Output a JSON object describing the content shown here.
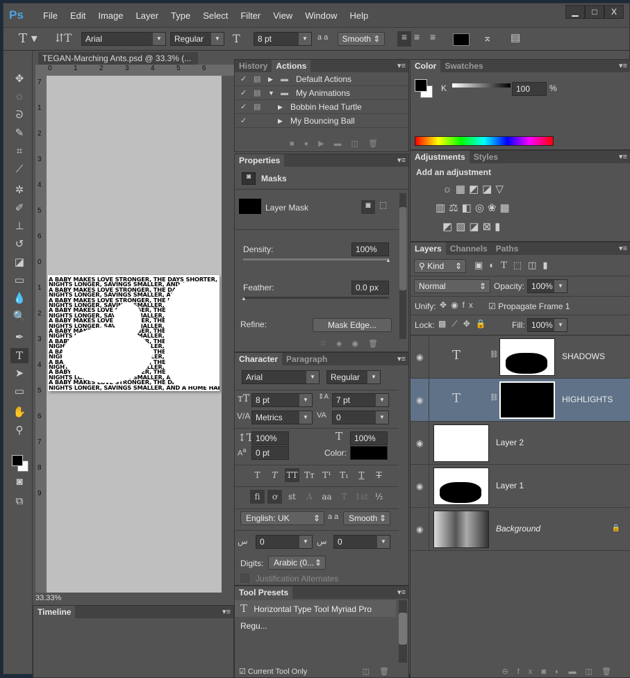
{
  "app": {
    "logo": "Ps",
    "menu": [
      "File",
      "Edit",
      "Image",
      "Layer",
      "Type",
      "Select",
      "Filter",
      "View",
      "Window",
      "Help"
    ],
    "window_buttons": [
      "minimize",
      "maximize",
      "close"
    ]
  },
  "options": {
    "tool_icon": "horizontal-type-icon",
    "font": "Arial",
    "style": "Regular",
    "size": "8 pt",
    "aa_label": "a a",
    "antialias": "Smooth",
    "text_color": "#000000"
  },
  "document": {
    "tab_title": "TEGAN-Marching Ants.psd @ 33.3% (...",
    "close": "×",
    "ruler_h": [
      "0",
      "1",
      "2",
      "3",
      "4",
      "5",
      "6"
    ],
    "ruler_v": [
      "7",
      "1",
      "2",
      "3",
      "4",
      "5",
      "6",
      "0",
      "1",
      "2",
      "3",
      "4",
      "5",
      "6",
      "7",
      "8",
      "9"
    ],
    "zoom": "33.33%",
    "art_text": [
      "A BABY MAKES LOVE STRONGER, THE DAYS SHORTER, THE",
      "NIGHTS LONGER, SAVINGS SMALLER, AND A HOME HAPPIERA"
    ]
  },
  "timeline": {
    "title": "Timeline"
  },
  "history_actions": {
    "tabs": [
      "History",
      "Actions"
    ],
    "items": [
      {
        "label": "Default Actions",
        "type": "set",
        "expanded": false
      },
      {
        "label": "My Animations",
        "type": "set",
        "expanded": true
      },
      {
        "label": "Bobbin Head Turtle",
        "type": "action"
      },
      {
        "label": "My Bouncing Ball",
        "type": "action"
      }
    ]
  },
  "properties": {
    "tab": "Properties",
    "section": "Masks",
    "mask_label": "Layer Mask",
    "density_label": "Density:",
    "density": "100%",
    "density_value": 100,
    "feather_label": "Feather:",
    "feather": "0.0 px",
    "feather_value": 0,
    "refine_label": "Refine:",
    "mask_edge": "Mask Edge..."
  },
  "character": {
    "tabs": [
      "Character",
      "Paragraph"
    ],
    "font": "Arial",
    "style": "Regular",
    "size": "8 pt",
    "leading": "7 pt",
    "kerning": "Metrics",
    "tracking": "0",
    "vscale": "100%",
    "hscale": "100%",
    "baseline": "0 pt",
    "color_label": "Color:",
    "color": "#000000",
    "type_buttons": [
      "T",
      "T",
      "TT",
      "Tт",
      "T¹",
      "T₁",
      "T",
      "T"
    ],
    "opentype_buttons": [
      "fi",
      "ơ",
      "st",
      "A",
      "aa",
      "T",
      "1st",
      "½"
    ],
    "language": "English: UK",
    "aa_label": "a a",
    "antialias": "Smooth",
    "arabic_1": "0",
    "arabic_2": "0",
    "digits_label": "Digits:",
    "digits": "Arabic (0...",
    "justification": "Justification Alternates"
  },
  "tool_presets": {
    "tab": "Tool Presets",
    "item": "Horizontal Type Tool Myriad Pro Regu...",
    "current_only": "Current Tool Only",
    "current_only_checked": true
  },
  "color": {
    "tabs": [
      "Color",
      "Swatches"
    ],
    "channel": "K",
    "value": "100",
    "unit": "%",
    "fg": "#000000",
    "bg": "#ffffff"
  },
  "adjustments": {
    "tabs": [
      "Adjustments",
      "Styles"
    ],
    "title": "Add an adjustment"
  },
  "layers": {
    "tabs": [
      "Layers",
      "Channels",
      "Paths"
    ],
    "filter": "Kind",
    "blend": "Normal",
    "opacity_label": "Opacity:",
    "opacity": "100%",
    "unify_label": "Unify:",
    "propagate": "Propagate Frame 1",
    "propagate_checked": true,
    "lock_label": "Lock:",
    "fill_label": "Fill:",
    "fill": "100%",
    "items": [
      {
        "name": "SHADOWS",
        "type": "text",
        "selected": false
      },
      {
        "name": "HIGHLIGHTS",
        "type": "text",
        "selected": true
      },
      {
        "name": "Layer 2",
        "type": "pixel",
        "selected": false
      },
      {
        "name": "Layer 1",
        "type": "pixel",
        "selected": false
      },
      {
        "name": "Background",
        "type": "background",
        "selected": false,
        "locked": true
      }
    ]
  }
}
